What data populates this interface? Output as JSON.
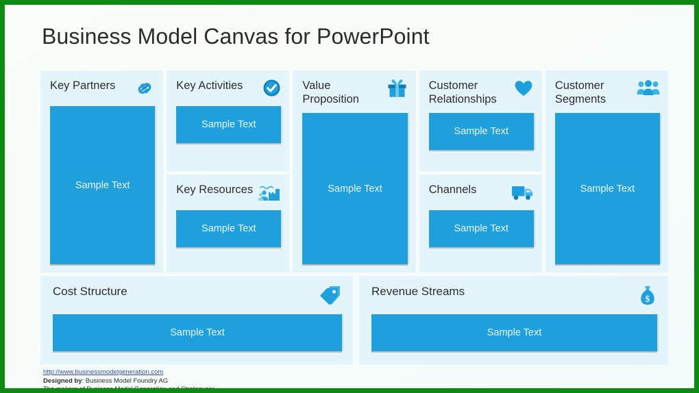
{
  "slide": {
    "title": "Business Model Canvas for PowerPoint",
    "border_color": "#0e8a12",
    "panel_bg": "#e3f4fa",
    "accent_blue": "#1f9fdc",
    "sample_text_color": "#eaf7fd"
  },
  "columns": [
    {
      "panels": [
        {
          "title": "Key Partners",
          "icon": "chain-link-icon",
          "body_text": "Sample Text",
          "size": "full"
        }
      ]
    },
    {
      "panels": [
        {
          "title": "Key Activities",
          "icon": "check-circle-icon",
          "body_text": "Sample Text",
          "size": "half-top"
        },
        {
          "title": "Key Resources",
          "icon": "factory-people-icon",
          "body_text": "Sample Text",
          "size": "half-bot"
        }
      ]
    },
    {
      "panels": [
        {
          "title": "Value Proposition",
          "icon": "gift-box-icon",
          "body_text": "Sample Text",
          "size": "full"
        }
      ]
    },
    {
      "panels": [
        {
          "title": "Customer Relationships",
          "icon": "heart-icon",
          "body_text": "Sample Text",
          "size": "half-top"
        },
        {
          "title": "Channels",
          "icon": "delivery-truck-icon",
          "body_text": "Sample Text",
          "size": "half-bot"
        }
      ]
    },
    {
      "panels": [
        {
          "title": "Customer Segments",
          "icon": "people-group-icon",
          "body_text": "Sample Text",
          "size": "full"
        }
      ]
    }
  ],
  "bottom": [
    {
      "title": "Cost Structure",
      "icon": "price-tag-icon",
      "body_text": "Sample Text"
    },
    {
      "title": "Revenue Streams",
      "icon": "money-bag-icon",
      "body_text": "Sample Text"
    }
  ],
  "footer": {
    "url": "http://www.businessmodelgeneration.com",
    "designed_by_label": "Designed by",
    "designed_by_value": ": Business Model Foundry AG",
    "makers_line": "The makers of Business Model Generation and Strategyzer"
  }
}
